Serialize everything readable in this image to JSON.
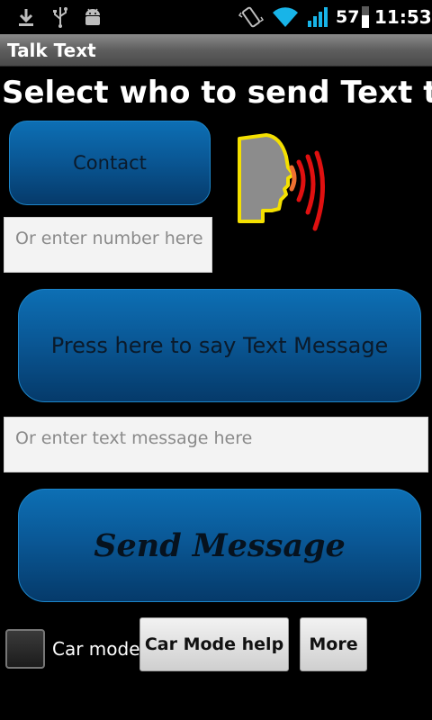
{
  "status_bar": {
    "icons": [
      "download-icon",
      "usb-icon",
      "android-debug-icon",
      "vibrate-icon",
      "wifi-icon",
      "signal-icon",
      "battery-icon"
    ],
    "battery_level": "57",
    "time": "11:53"
  },
  "app": {
    "title": "Talk Text"
  },
  "main": {
    "heading": "Select who to send Text to",
    "contact_label": "Contact",
    "number_placeholder": "Or enter number here",
    "speak_label": "Press here to say Text Message",
    "message_placeholder": "Or enter text message here",
    "send_label": "Send Message"
  },
  "bottom": {
    "car_mode_label": "Car mode",
    "car_mode_checked": false,
    "help_label": "Car Mode help",
    "more_label": "More"
  },
  "colors": {
    "button_blue": "#0a5896",
    "speaker_outline": "#f4e000",
    "speaker_face": "#8c8c8c",
    "sound_wave_red": "#e01010",
    "sound_wave_orange": "#f07030"
  }
}
